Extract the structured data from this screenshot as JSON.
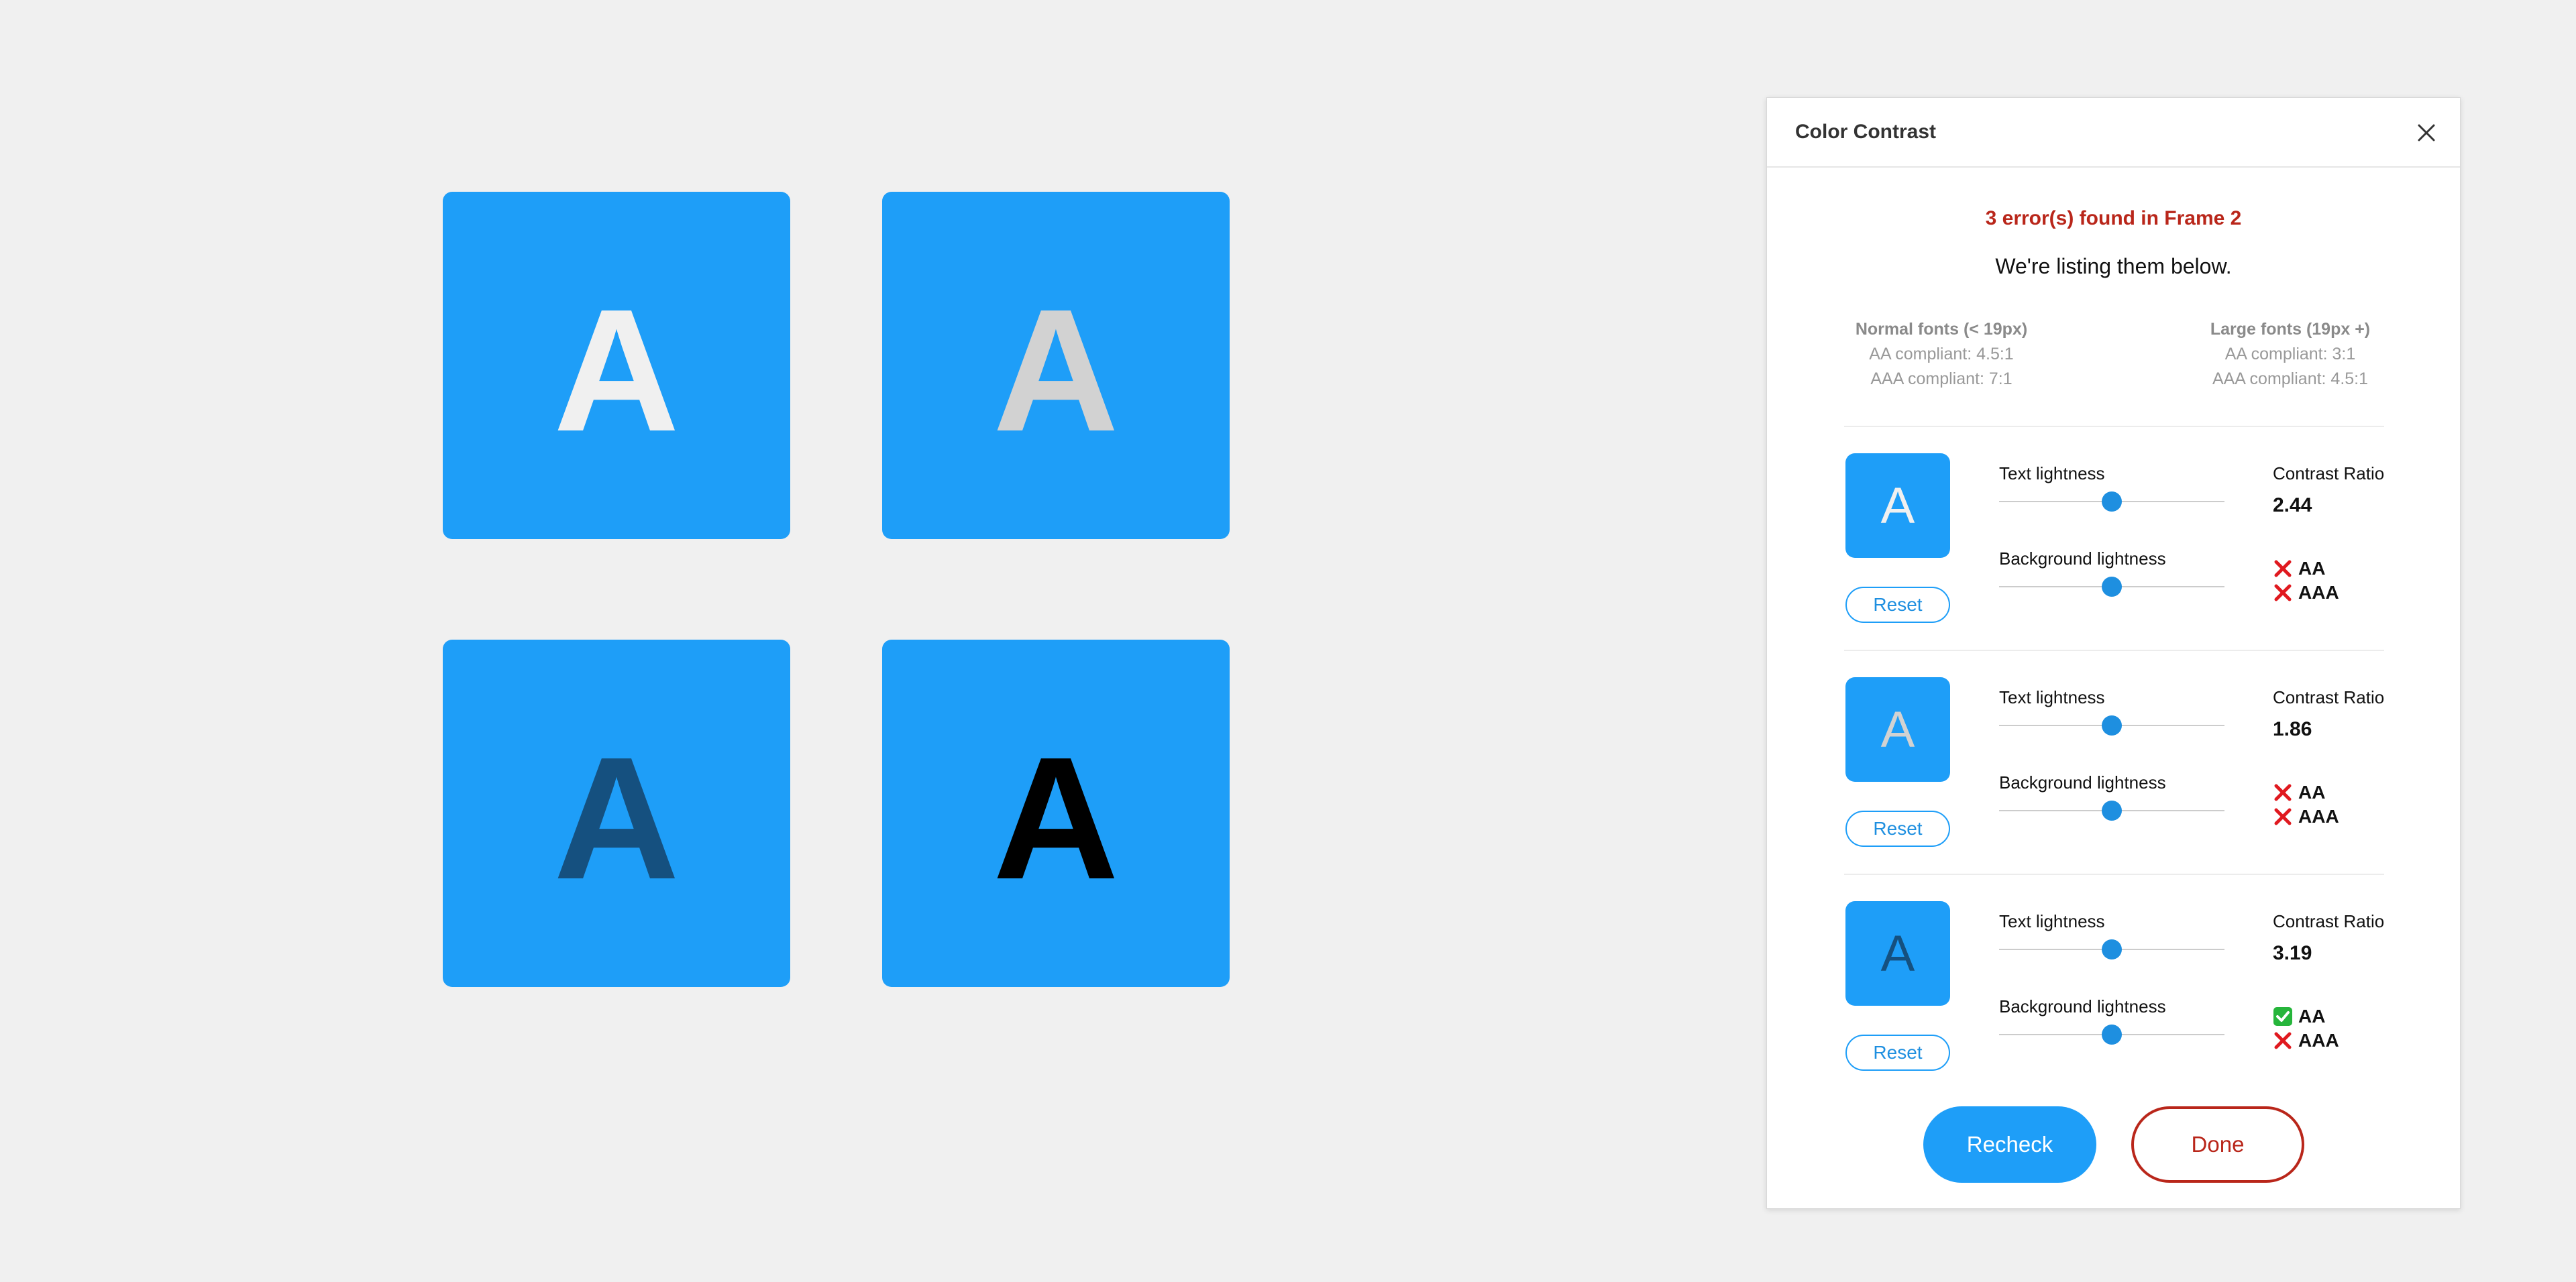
{
  "colors": {
    "canvas_bg": "#f0f0f0",
    "tile_blue": "#1e9ef8",
    "error_red": "#b9261a",
    "accent_blue": "#1e8fe0",
    "fail_red": "#e0191f",
    "pass_green": "#26b53b"
  },
  "tiles": [
    {
      "letter": "A",
      "text_color": "#f0f0f0",
      "bg_color": "#1e9ef8"
    },
    {
      "letter": "A",
      "text_color": "#d2d2d2",
      "bg_color": "#1e9ef8"
    },
    {
      "letter": "A",
      "text_color": "#15507f",
      "bg_color": "#1e9ef8"
    },
    {
      "letter": "A",
      "text_color": "#000000",
      "bg_color": "#1e9ef8"
    }
  ],
  "panel": {
    "title": "Color Contrast",
    "close_icon": "close-icon",
    "error_message": "3 error(s) found in Frame 2",
    "sub_message": "We're listing them below.",
    "normal_fonts": {
      "heading": "Normal fonts (< 19px)",
      "aa": "AA compliant: 4.5:1",
      "aaa": "AAA compliant: 7:1"
    },
    "large_fonts": {
      "heading": "Large fonts (19px +)",
      "aa": "AA compliant: 3:1",
      "aaa": "AAA compliant: 4.5:1"
    },
    "text_lightness_label": "Text lightness",
    "background_lightness_label": "Background lightness",
    "contrast_ratio_label": "Contrast Ratio",
    "reset_label": "Reset",
    "aa_label": "AA",
    "aaa_label": "AAA",
    "errors": [
      {
        "letter": "A",
        "text_color": "#f0f0f0",
        "bg_color": "#1e9ef8",
        "text_lightness": 0.5,
        "background_lightness": 0.5,
        "ratio": "2.44",
        "aa_pass": false,
        "aaa_pass": false
      },
      {
        "letter": "A",
        "text_color": "#d2d2d2",
        "bg_color": "#1e9ef8",
        "text_lightness": 0.5,
        "background_lightness": 0.5,
        "ratio": "1.86",
        "aa_pass": false,
        "aaa_pass": false
      },
      {
        "letter": "A",
        "text_color": "#15507f",
        "bg_color": "#1e9ef8",
        "text_lightness": 0.5,
        "background_lightness": 0.5,
        "ratio": "3.19",
        "aa_pass": true,
        "aaa_pass": false
      }
    ],
    "recheck_label": "Recheck",
    "done_label": "Done"
  }
}
